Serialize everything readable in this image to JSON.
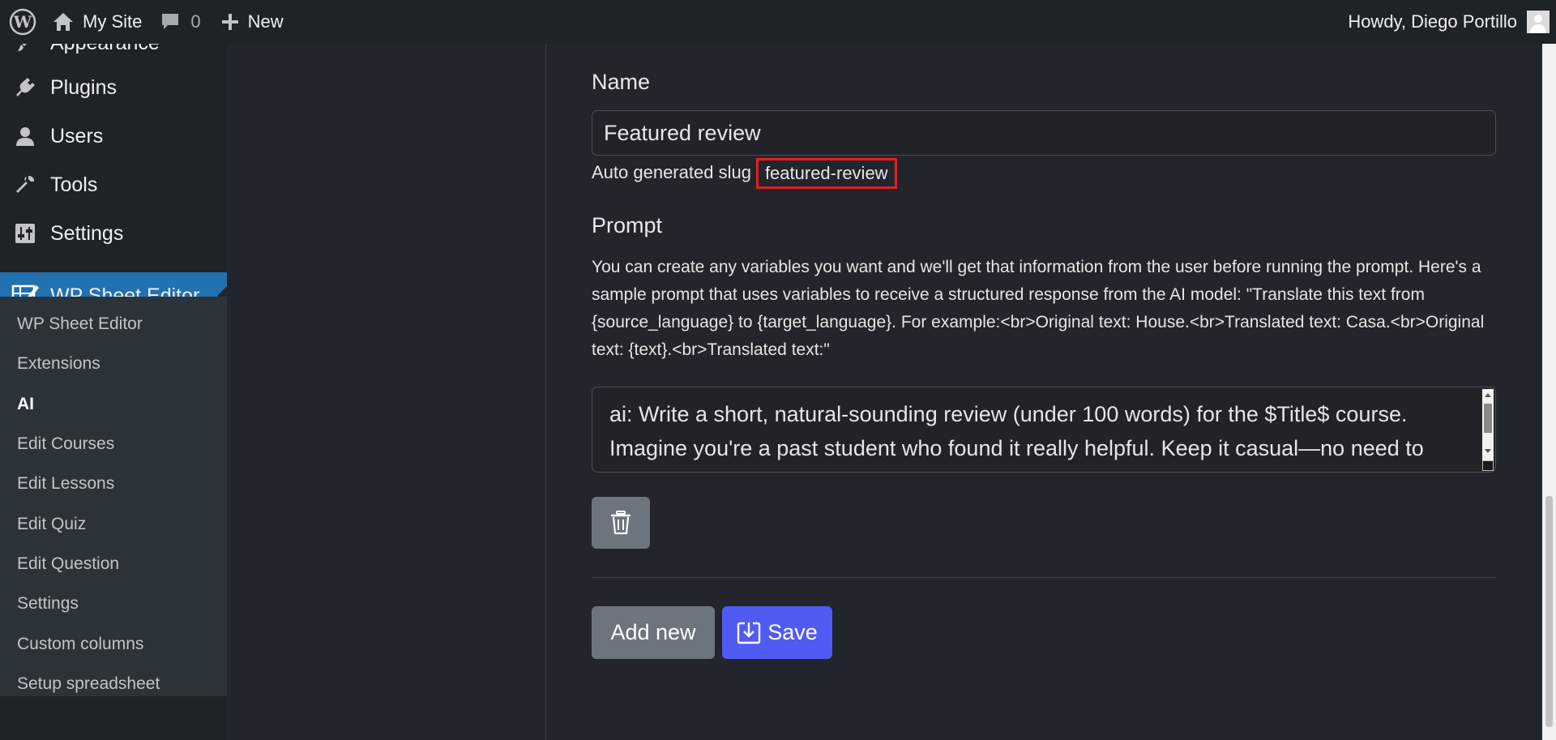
{
  "adminbar": {
    "site_name": "My Site",
    "comments_count": "0",
    "new_label": "New",
    "howdy": "Howdy, Diego Portillo"
  },
  "sidebar": {
    "items": [
      {
        "label": "Appearance",
        "icon": "paintbrush-icon"
      },
      {
        "label": "Plugins",
        "icon": "plug-icon"
      },
      {
        "label": "Users",
        "icon": "user-icon"
      },
      {
        "label": "Tools",
        "icon": "wrench-icon"
      },
      {
        "label": "Settings",
        "icon": "sliders-icon"
      },
      {
        "label": "WP Sheet Editor",
        "icon": "sheet-editor-icon"
      }
    ],
    "submenu": [
      "WP Sheet Editor",
      "Extensions",
      "AI",
      "Edit Courses",
      "Edit Lessons",
      "Edit Quiz",
      "Edit Question",
      "Settings",
      "Custom columns",
      "Setup spreadsheet"
    ],
    "active_submenu": "AI"
  },
  "form": {
    "name_label": "Name",
    "name_value": "Featured review",
    "slug_label": "Auto generated slug",
    "slug_value": "featured-review",
    "prompt_label": "Prompt",
    "prompt_help": "You can create any variables you want and we'll get that information from the user before running the prompt. Here's a sample prompt that uses variables to receive a structured response from the AI model: \"Translate this text from {source_language} to {target_language}. For example:<br>Original text: House.<br>Translated text: Casa.<br>Original text: {text}.<br>Translated text:\"",
    "prompt_value": "ai: Write a short, natural-sounding review (under 100 words) for the $Title$ course. Imagine you're a past student who found it really helpful. Keep it casual—no need to",
    "add_new_label": "Add new",
    "save_label": "Save"
  },
  "colors": {
    "accent": "#2271b1",
    "save_button": "#4f5bf2",
    "slug_highlight": "#e02020"
  }
}
